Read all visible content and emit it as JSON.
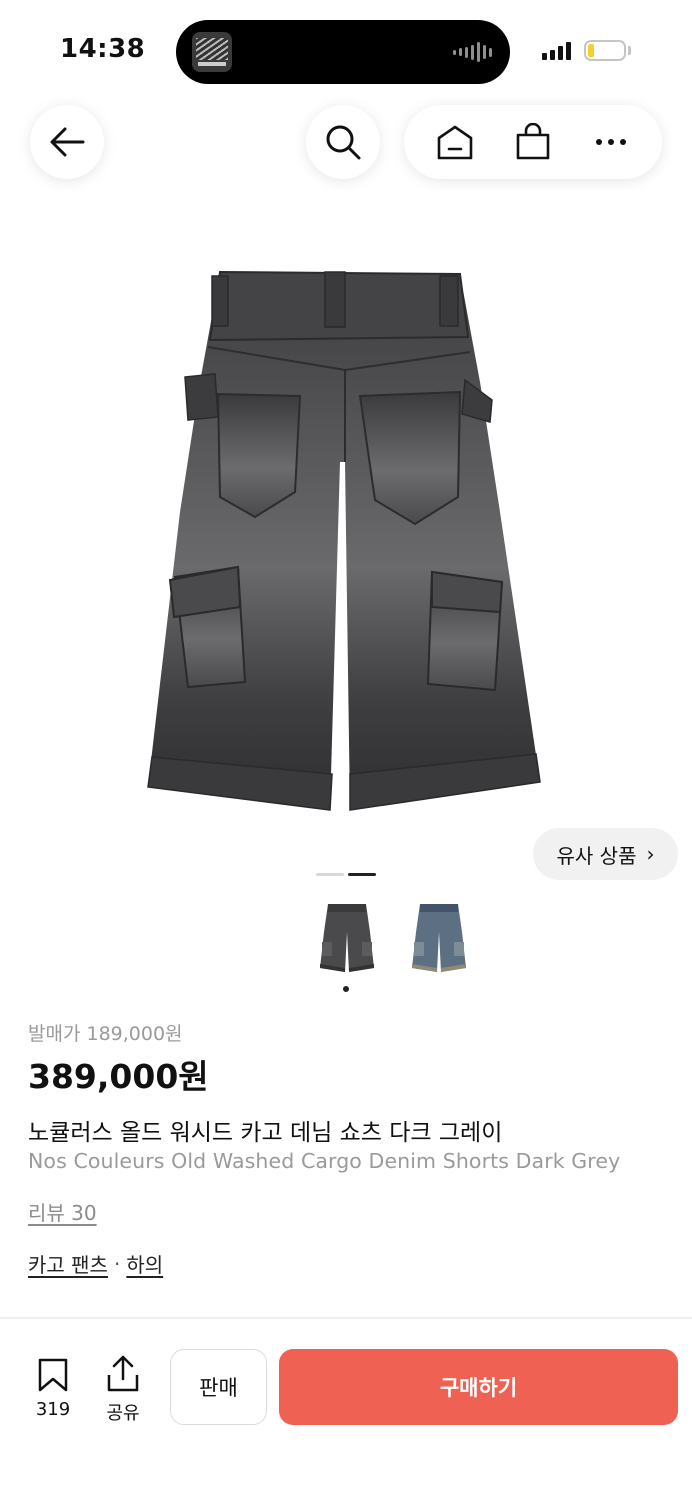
{
  "status_bar": {
    "time": "14:38",
    "island_app_icon": "MAPE",
    "battery_color": "#f7cf2c"
  },
  "nav": {
    "back_icon": "arrow-left-icon",
    "search_icon": "search-icon",
    "home_icon": "home-icon",
    "cart_icon": "shopping-bag-icon",
    "more_icon": "more-icon"
  },
  "gallery": {
    "similar_label": "유사 상품",
    "similar_chevron": "›",
    "slides_total": 2,
    "slide_active": 2,
    "thumbnails": [
      "dark-grey-denim-shorts",
      "light-blue-denim-shorts"
    ]
  },
  "product": {
    "release_price": "발매가 189,000원",
    "price": "389,000원",
    "title_ko": "노큘러스 올드 워시드 카고 데님 쇼츠 다크 그레이",
    "title_en": "Nos Couleurs Old Washed Cargo Denim Shorts Dark Grey",
    "reviews": "리뷰 30",
    "categories": [
      "카고 팬츠",
      "하의"
    ],
    "category_separator": "·"
  },
  "bottom_bar": {
    "bookmark_count": "319",
    "share_label": "공유",
    "sell_label": "판매",
    "buy_label": "구매하기",
    "buy_color": "#ef6253"
  }
}
